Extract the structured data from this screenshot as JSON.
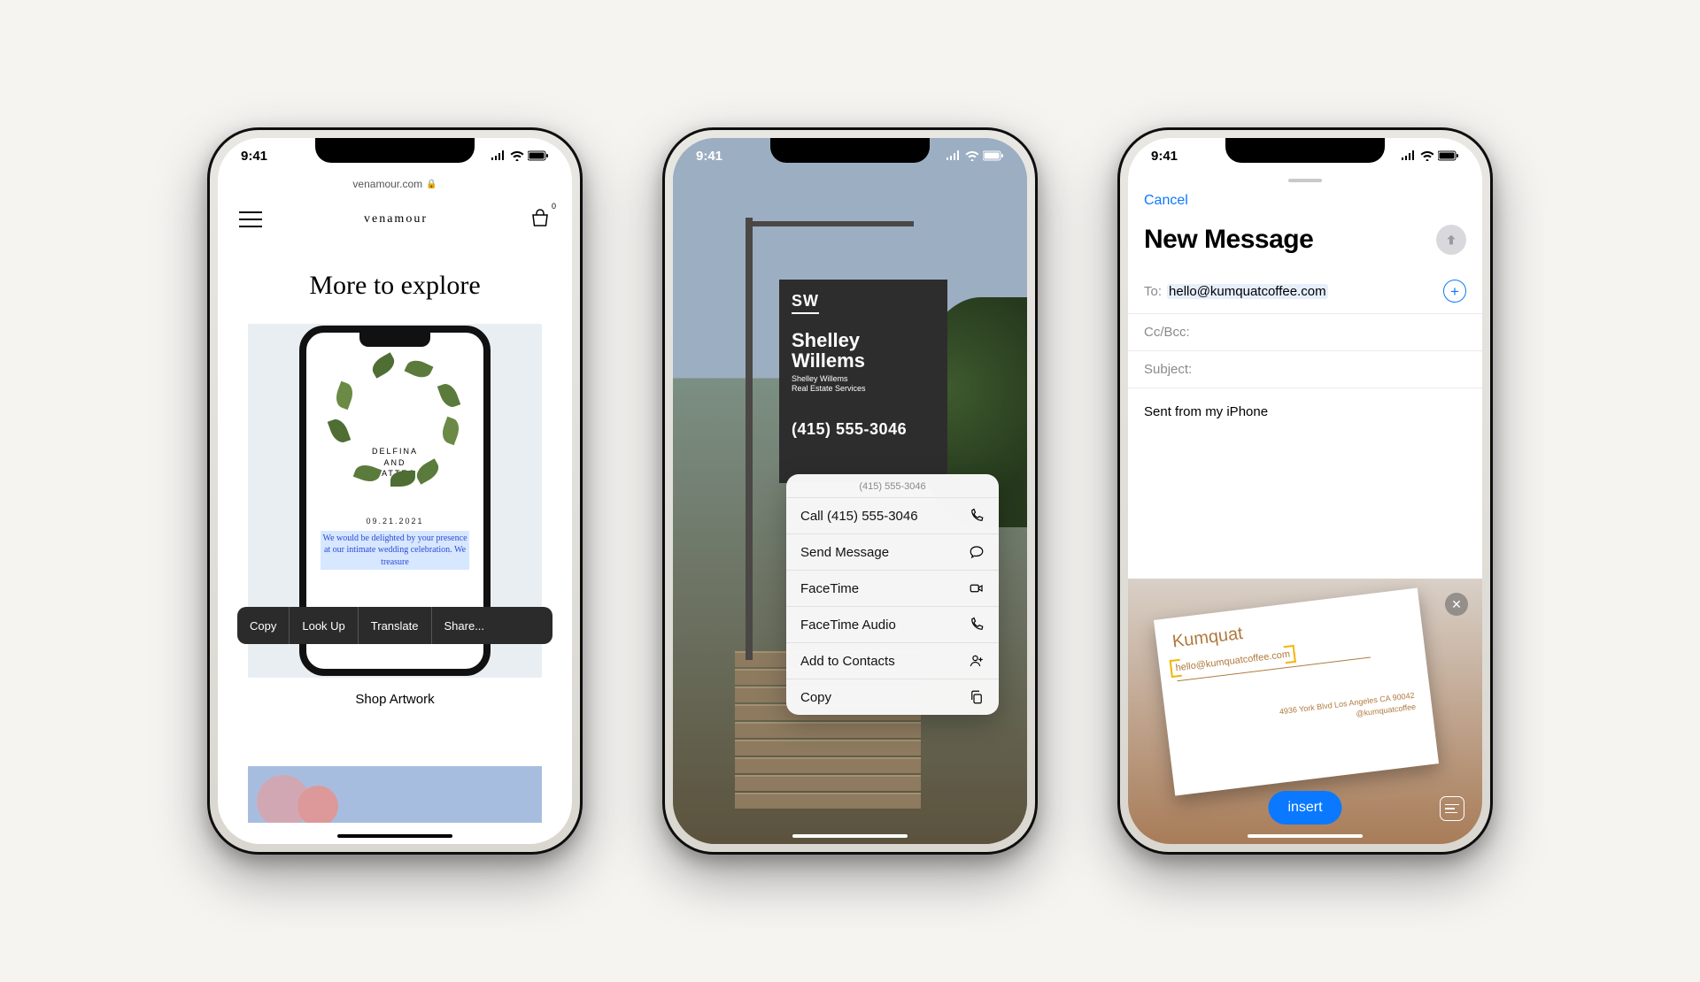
{
  "status": {
    "time": "9:41"
  },
  "phone1": {
    "url": "venamour.com",
    "brand": "venamour",
    "cart_badge": "0",
    "hero": "More to explore",
    "inv_name1": "DELFINA",
    "inv_name_and": "AND",
    "inv_name2": "MATTEO",
    "inv_date": "09.21.2021",
    "inv_text": "We would be delighted by your presence at our intimate wedding celebration. We treasure",
    "selection": {
      "copy": "Copy",
      "lookup": "Look Up",
      "translate": "Translate",
      "share": "Share..."
    },
    "caption": "Shop Artwork"
  },
  "phone2": {
    "sign": {
      "sw": "SW",
      "name1": "Shelley",
      "name2": "Willems",
      "sub1": "Shelley Willems",
      "sub2": "Real Estate Services",
      "phone": "(415) 555-3046"
    },
    "ctx_title": "(415) 555-3046",
    "menu": {
      "call": "Call (415) 555-3046",
      "message": "Send Message",
      "facetime": "FaceTime",
      "ft_audio": "FaceTime Audio",
      "add": "Add to Contacts",
      "copy": "Copy"
    }
  },
  "phone3": {
    "cancel": "Cancel",
    "title": "New Message",
    "to_label": "To:",
    "to_value": "hello@kumquatcoffee.com",
    "ccbcc": "Cc/Bcc:",
    "subject": "Subject:",
    "body_sig": "Sent from my iPhone",
    "card": {
      "name": "Kumquat",
      "email": "hello@kumquatcoffee.com",
      "addr1": "4936 York Blvd Los Angeles CA 90042",
      "addr2": "@kumquatcoffee"
    },
    "insert": "insert"
  }
}
